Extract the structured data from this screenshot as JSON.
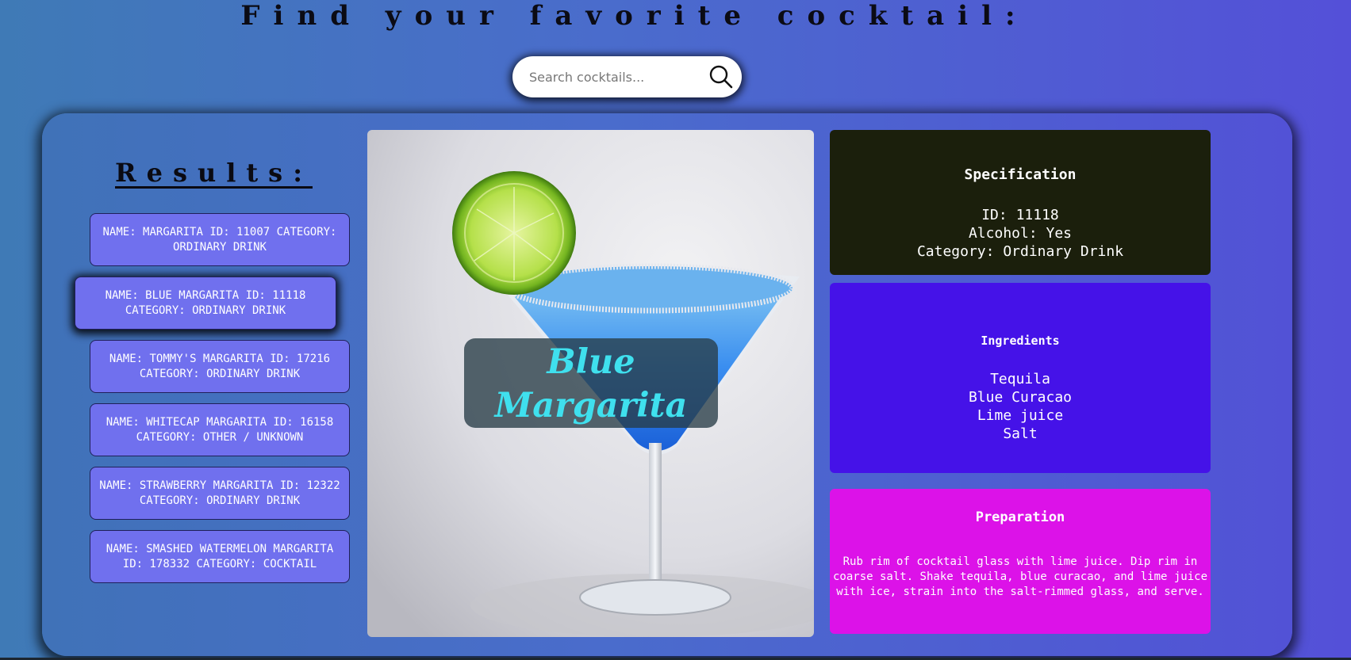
{
  "header": {
    "title": "Find your favorite cocktail:"
  },
  "search": {
    "placeholder": "Search cocktails...",
    "value": "",
    "button_icon": "search-icon"
  },
  "results": {
    "heading": "Results:",
    "items": [
      {
        "label": "NAME: MARGARITA ID: 11007 CATEGORY: ORDINARY DRINK",
        "selected": false
      },
      {
        "label": "NAME: BLUE MARGARITA ID: 11118 CATEGORY: ORDINARY DRINK",
        "selected": true
      },
      {
        "label": "NAME: TOMMY'S MARGARITA ID: 17216 CATEGORY: ORDINARY DRINK",
        "selected": false
      },
      {
        "label": "NAME: WHITECAP MARGARITA ID: 16158 CATEGORY: OTHER / UNKNOWN",
        "selected": false
      },
      {
        "label": "NAME: STRAWBERRY MARGARITA ID: 12322 CATEGORY: ORDINARY DRINK",
        "selected": false
      },
      {
        "label": "NAME: SMASHED WATERMELON MARGARITA ID: 178332 CATEGORY: COCKTAIL",
        "selected": false
      }
    ]
  },
  "cocktail": {
    "name_line1": "Blue",
    "name_line2": "Margarita",
    "image_icon": "cocktail-glass-photo"
  },
  "specification": {
    "title": "Specification",
    "id_line": "ID: 11118",
    "alcohol_line": "Alcohol: Yes",
    "category_line": "Category: Ordinary Drink"
  },
  "ingredients": {
    "title": "Ingredients",
    "items": [
      "Tequila",
      "Blue Curacao",
      "Lime juice",
      "Salt"
    ]
  },
  "preparation": {
    "title": "Preparation",
    "text": "Rub rim of cocktail glass with lime juice. Dip rim in coarse salt. Shake tequila, blue curacao, and lime juice with ice, strain into the salt-rimmed glass, and serve."
  },
  "colors": {
    "background_start": "#3f7ab6",
    "background_end": "#5450d8",
    "result_item": "#7070ee",
    "specification_card": "#1b1f0c",
    "ingredients_card": "#4512e8",
    "preparation_card": "#dc12e8",
    "cocktail_name_text": "#3fe0ee"
  }
}
